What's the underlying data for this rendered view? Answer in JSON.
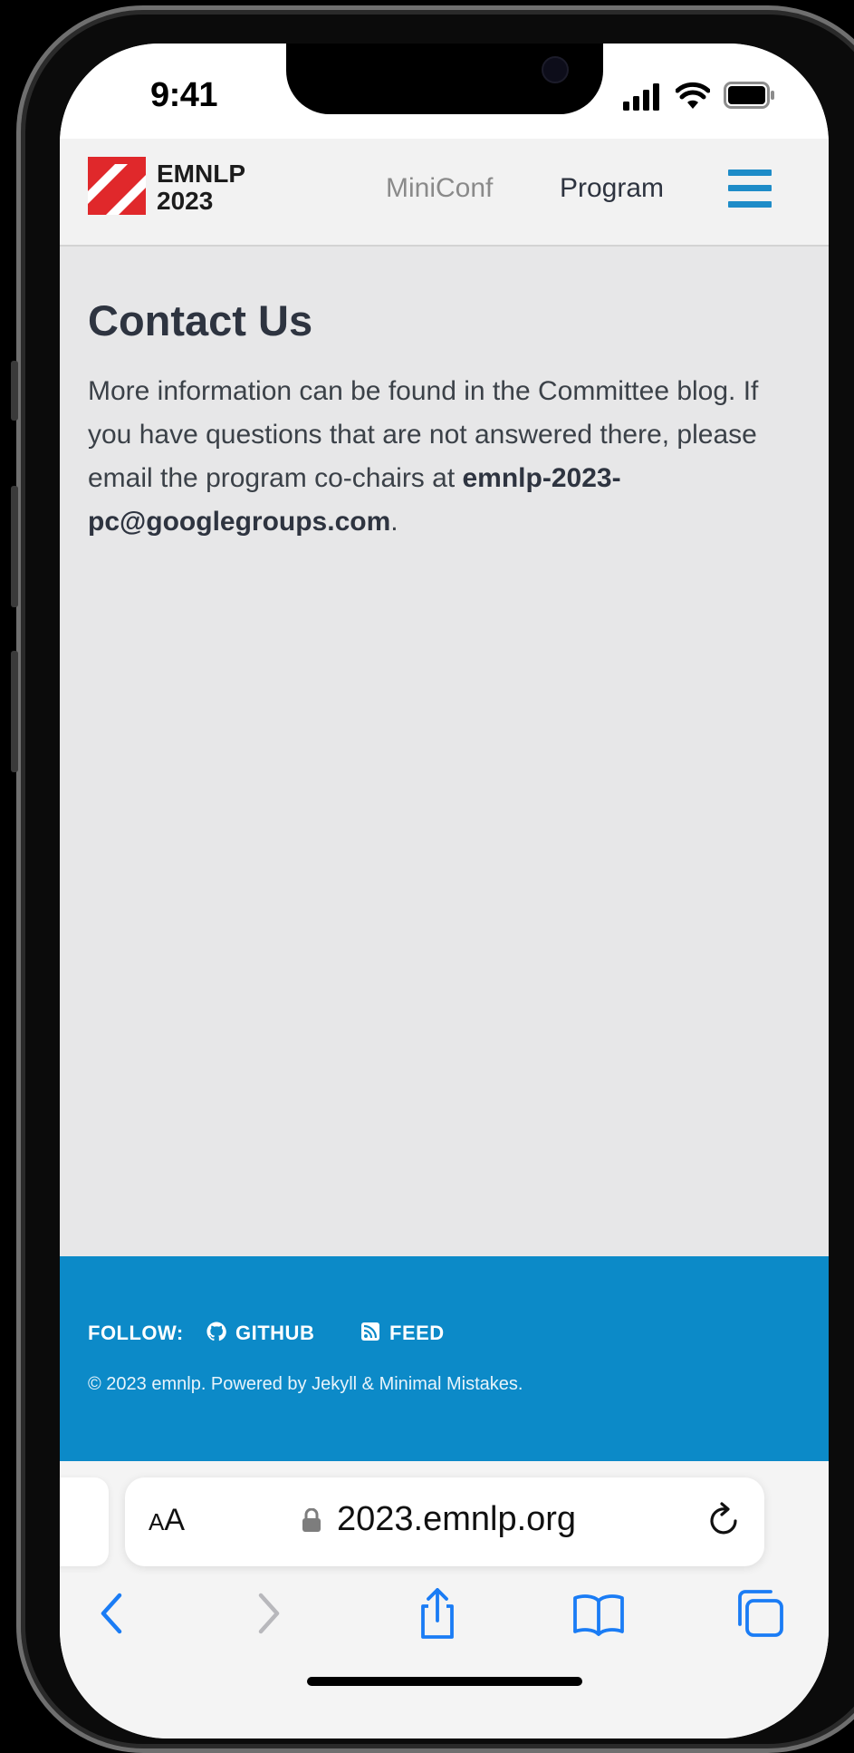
{
  "status_bar": {
    "time": "9:41"
  },
  "header": {
    "logo_line1": "EMNLP",
    "logo_line2": "2023",
    "nav": [
      {
        "label": "MiniConf"
      },
      {
        "label": "Program"
      }
    ]
  },
  "content": {
    "title": "Contact Us",
    "paragraph_text": "More information can be found in the Committee blog. If you have questions that are not answered there, please email the program co-chairs at ",
    "email": "emnlp-2023-pc@googlegroups.com",
    "paragraph_end": "."
  },
  "footer": {
    "follow_label": "FOLLOW:",
    "github_label": "GITHUB",
    "feed_label": "FEED",
    "copyright": "© 2023 emnlp. Powered by Jekyll & Minimal Mistakes."
  },
  "browser": {
    "text_size_label": "AA",
    "url": "2023.emnlp.org"
  },
  "colors": {
    "accent_blue": "#0c8ac8",
    "hamburger_blue": "#1e8cc8",
    "page_background": "#e7e7e8",
    "logo_red": "#e0282b"
  }
}
